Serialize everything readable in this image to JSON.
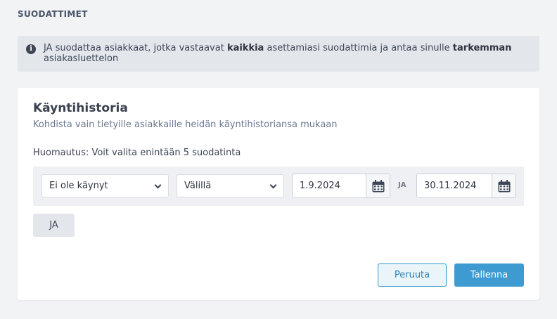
{
  "section": {
    "title": "SUODATTIMET"
  },
  "info": {
    "icon": "info-circle-icon",
    "text_1": "JA suodattaa asiakkaat, jotka vastaavat ",
    "bold_1": "kaikkia",
    "text_2": " asettamiasi suodattimia ja antaa sinulle ",
    "bold_2": "tarkemman",
    "text_3": " asiakasluettelon"
  },
  "card": {
    "title": "Käyntihistoria",
    "subtitle": "Kohdista vain tietyille asiakkaille heidän käyntihistoriansa mukaan",
    "note": "Huomautus: Voit valita enintään 5 suodatinta"
  },
  "filter": {
    "status_select": "Ei ole käynyt",
    "range_select": "Välillä",
    "date_from": "1.9.2024",
    "connector": "JA",
    "date_to": "30.11.2024",
    "calendar_icon": "calendar-icon",
    "chevron_icon": "chevron-down-icon"
  },
  "actions": {
    "and_button": "JA",
    "cancel": "Peruuta",
    "save": "Tallenna"
  },
  "colors": {
    "background": "#f2f3f5",
    "info_bg": "#e3e6eb",
    "accent": "#3d9bd2",
    "cancel_bg": "#eaf5fa"
  }
}
